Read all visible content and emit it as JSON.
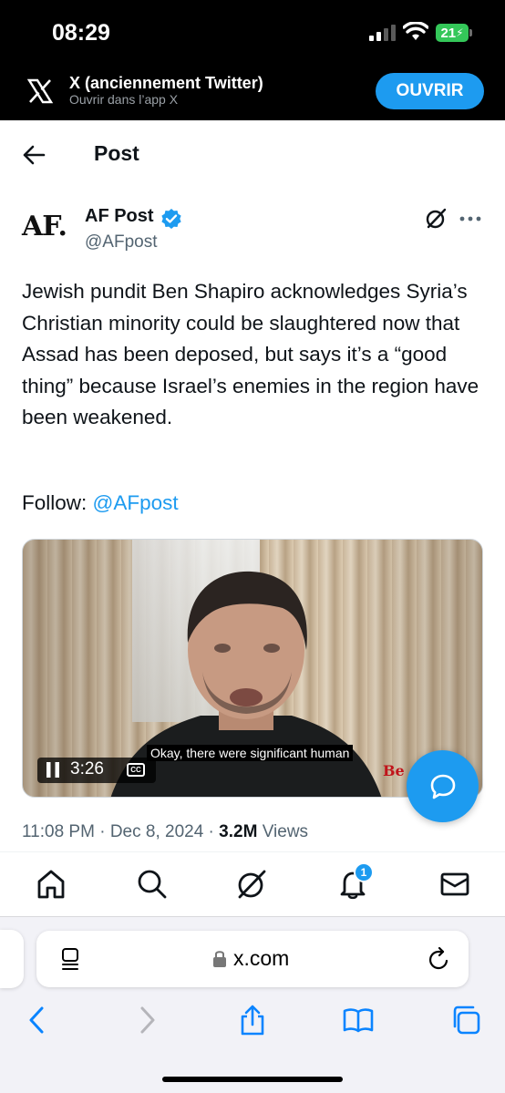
{
  "status_bar": {
    "time": "08:29",
    "battery": "21"
  },
  "app_banner": {
    "title": "X (anciennement Twitter)",
    "subtitle": "Ouvrir dans l’app X",
    "open_label": "OUVRIR"
  },
  "header": {
    "title": "Post"
  },
  "author": {
    "logo_text": "AF.",
    "name": "AF Post",
    "handle": "@AFpost"
  },
  "post": {
    "text": "Jewish pundit Ben Shapiro acknowledges Syria’s Christian minority could be slaughtered now that Assad has been deposed, but says it’s a “good thing” because Israel’s enemies in the region have been weakened.",
    "follow_prefix": "Follow: ",
    "follow_handle": "@AFpost"
  },
  "video": {
    "subtitle": "Okay, there were significant human",
    "time_remaining": "3:26",
    "cc_label": "CC",
    "channel_mark": "Be"
  },
  "meta": {
    "time": "11:08 PM",
    "sep1": " · ",
    "date": "Dec 8, 2024",
    "sep2": " · ",
    "views_count": "3.2M",
    "views_label": " Views"
  },
  "bottom_nav": {
    "notification_count": "1"
  },
  "browser": {
    "url": "x.com"
  },
  "colors": {
    "accent": "#1d9bf0",
    "text": "#0f1419",
    "secondary": "#536471"
  }
}
